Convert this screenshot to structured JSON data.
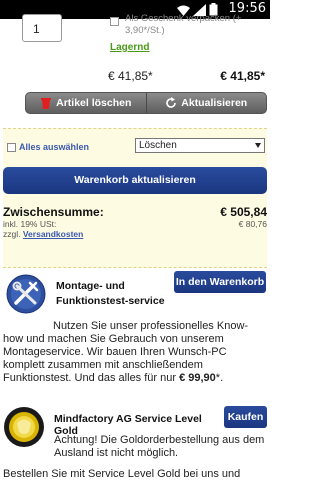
{
  "statusbar": {
    "time": "19:56"
  },
  "item": {
    "quantity": "1",
    "gift_wrap_label": "Als Geschenk verpacken (+ 3,90*/St.)",
    "availability": "Lagernd",
    "unit_price": "€ 41,85*",
    "total_price": "€ 41,85*"
  },
  "actions": {
    "delete_label": "Artikel löschen",
    "refresh_label": "Aktualisieren"
  },
  "cart_box": {
    "select_all_label": "Alles auswählen",
    "dropdown_value": "Löschen",
    "update_button_label": "Warenkorb aktualisieren",
    "subtotal_label": "Zwischensumme:",
    "subtotal_value": "€ 505,84",
    "vat_label": "inkl. 19% USt:",
    "vat_value": "€ 80,76",
    "shipping_prefix": "zzgl.",
    "shipping_link": "Versandkosten"
  },
  "service1": {
    "title": "Montage- und Funktionstest-service",
    "button_label": "In den Warenkorb",
    "description_main": "Nutzen Sie unser professionelles Know-how und machen Sie Gebrauch von unserem Montageservice. Wir bauen Ihren Wunsch-PC komplett zusammen mit anschließendem Funktionstest. Und das alles für nur ",
    "description_price": "€ 99,90",
    "description_suffix": "*."
  },
  "service2": {
    "title": "Mindfactory AG Service Level Gold",
    "button_label": "Kaufen",
    "warning": "Achtung! Die Goldorderbestellung aus dem Ausland ist nicht möglich.",
    "more_text": "Bestellen Sie mit Service Level Gold bei uns und"
  },
  "colors": {
    "accent_blue": "#1f3f8f",
    "availability_green": "#4a9a1a",
    "cart_box_bg": "#fefbe3"
  }
}
